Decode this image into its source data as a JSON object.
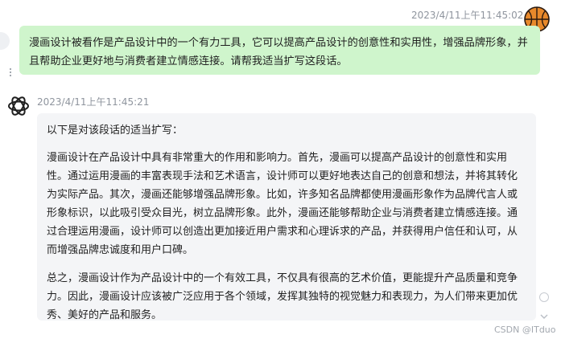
{
  "user_message": {
    "timestamp": "2023/4/11上午11:45:02",
    "text": "漫画设计被看作是产品设计中的一个有力工具，它可以提高产品设计的创意性和实用性，增强品牌形象，并且帮助企业更好地与消费者建立情感连接。请帮我适当扩写这段话。",
    "avatar_icon": "basketball-avatar-icon"
  },
  "assistant_message": {
    "timestamp": "2023/4/11上午11:45:21",
    "avatar_icon": "openai-logo-icon",
    "intro": "以下是对该段话的适当扩写：",
    "paragraph_1": "漫画设计在产品设计中具有非常重大的作用和影响力。首先，漫画可以提高产品设计的创意性和实用性。通过运用漫画的丰富表现手法和艺术语言，设计师可以更好地表达自己的创意和想法，并将其转化为实际产品。其次，漫画还能够增强品牌形象。比如，许多知名品牌都使用漫画形象作为品牌代言人或形象标识，以此吸引受众目光，树立品牌形象。此外，漫画还能够帮助企业与消费者建立情感连接。通过合理运用漫画，设计师可以创造出更加接近用户需求和心理诉求的产品，并获得用户信任和认可，从而增强品牌忠诚度和用户口碑。",
    "paragraph_2": "总之，漫画设计作为产品设计中的一个有效工具，不仅具有很高的艺术价值，更能提升产品质量和竞争力。因此，漫画设计应该被广泛应用于各个领域，发挥其独特的视觉魅力和表现力，为人们带来更加优秀、美好的产品和服务。"
  },
  "watermark": "CSDN @ITduo",
  "colors": {
    "user_bubble": "#cff5cc",
    "assistant_bubble": "#f4f5f7",
    "timestamp": "#8f959e"
  }
}
